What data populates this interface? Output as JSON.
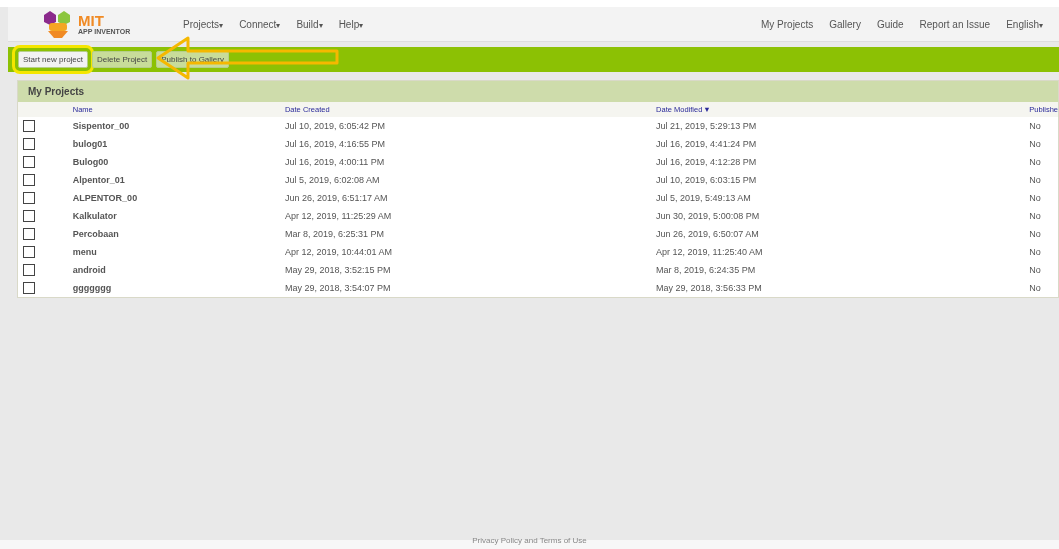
{
  "header": {
    "logo": {
      "title": "MIT",
      "subtitle": "APP INVENTOR"
    },
    "menus": [
      {
        "label": "Projects",
        "caret": "▾"
      },
      {
        "label": "Connect",
        "caret": "▾"
      },
      {
        "label": "Build",
        "caret": "▾"
      },
      {
        "label": "Help",
        "caret": "▾"
      }
    ],
    "links": [
      {
        "label": "My Projects"
      },
      {
        "label": "Gallery"
      },
      {
        "label": "Guide"
      },
      {
        "label": "Report an Issue"
      },
      {
        "label": "English",
        "caret": "▾"
      }
    ]
  },
  "toolbar": {
    "buttons": [
      {
        "label": "Start new project",
        "selected": true
      },
      {
        "label": "Delete Project",
        "selected": false
      },
      {
        "label": "Publish to Gallery",
        "selected": false
      }
    ]
  },
  "panel": {
    "title": "My Projects",
    "columns": [
      {
        "label": "Name"
      },
      {
        "label": "Date Created"
      },
      {
        "label": "Date Modified",
        "sort": "▼"
      },
      {
        "label": "Publishe"
      }
    ],
    "rows": [
      {
        "checked": false,
        "name": "Sispentor_00",
        "created": "Jul 10, 2019, 6:05:42 PM",
        "modified": "Jul 21, 2019, 5:29:13 PM",
        "published": "No"
      },
      {
        "checked": false,
        "name": "bulog01",
        "created": "Jul 16, 2019, 4:16:55 PM",
        "modified": "Jul 16, 2019, 4:41:24 PM",
        "published": "No"
      },
      {
        "checked": false,
        "name": "Bulog00",
        "created": "Jul 16, 2019, 4:00:11 PM",
        "modified": "Jul 16, 2019, 4:12:28 PM",
        "published": "No"
      },
      {
        "checked": false,
        "name": "Alpentor_01",
        "created": "Jul 5, 2019, 6:02:08 AM",
        "modified": "Jul 10, 2019, 6:03:15 PM",
        "published": "No"
      },
      {
        "checked": false,
        "name": "ALPENTOR_00",
        "created": "Jun 26, 2019, 6:51:17 AM",
        "modified": "Jul 5, 2019, 5:49:13 AM",
        "published": "No"
      },
      {
        "checked": false,
        "name": "Kalkulator",
        "created": "Apr 12, 2019, 11:25:29 AM",
        "modified": "Jun 30, 2019, 5:00:08 PM",
        "published": "No"
      },
      {
        "checked": false,
        "name": "Percobaan",
        "created": "Mar 8, 2019, 6:25:31 PM",
        "modified": "Jun 26, 2019, 6:50:07 AM",
        "published": "No"
      },
      {
        "checked": false,
        "name": "menu",
        "created": "Apr 12, 2019, 10:44:01 AM",
        "modified": "Apr 12, 2019, 11:25:40 AM",
        "published": "No"
      },
      {
        "checked": false,
        "name": "android",
        "created": "May 29, 2018, 3:52:15 PM",
        "modified": "Mar 8, 2019, 6:24:35 PM",
        "published": "No"
      },
      {
        "checked": false,
        "name": "ggggggg",
        "created": "May 29, 2018, 3:54:07 PM",
        "modified": "May 29, 2018, 3:56:33 PM",
        "published": "No"
      }
    ]
  },
  "footer": {
    "text": "Privacy Policy and Terms of Use"
  }
}
